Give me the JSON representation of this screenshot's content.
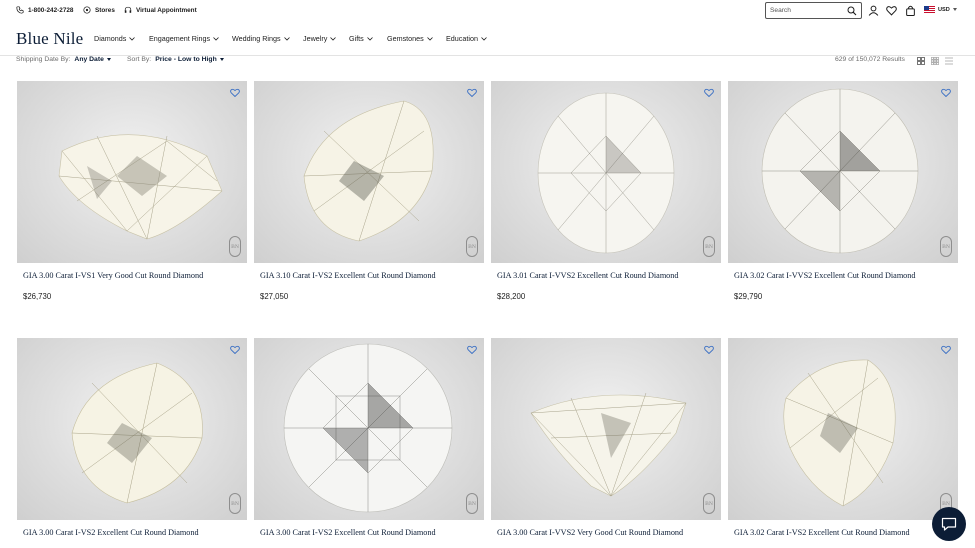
{
  "utility": {
    "phone": "1-800-242-2728",
    "stores": "Stores",
    "virtual": "Virtual Appointment",
    "search_placeholder": "Search",
    "currency": "USD"
  },
  "brand": {
    "name": "Blue Nile"
  },
  "nav": [
    "Diamonds",
    "Engagement Rings",
    "Wedding Rings",
    "Jewelry",
    "Gifts",
    "Gemstones",
    "Education"
  ],
  "filters": {
    "shipping_label": "Shipping Date By:",
    "shipping_value": "Any Date",
    "sort_label": "Sort By:",
    "sort_value": "Price - Low to High",
    "results": "629 of 150,072 Results"
  },
  "products": [
    {
      "title": "GIA 3.00 Carat I-VS1 Very Good Cut Round Diamond",
      "price": "$26,730"
    },
    {
      "title": "GIA 3.10 Carat I-VS2 Excellent Cut Round Diamond",
      "price": "$27,050"
    },
    {
      "title": "GIA 3.01 Carat I-VVS2 Excellent Cut Round Diamond",
      "price": "$28,200"
    },
    {
      "title": "GIA 3.02 Carat I-VVS2 Excellent Cut Round Diamond",
      "price": "$29,790"
    },
    {
      "title": "GIA 3.00 Carat I-VS2 Excellent Cut Round Diamond",
      "price": ""
    },
    {
      "title": "GIA 3.00 Carat I-VS2 Excellent Cut Round Diamond",
      "price": ""
    },
    {
      "title": "GIA 3.00 Carat I-VVS2 Very Good Cut Round Diamond",
      "price": ""
    },
    {
      "title": "GIA 3.02 Carat I-VS2 Excellent Cut Round Diamond",
      "price": ""
    }
  ],
  "watermark": "BN",
  "colors": {
    "brand_navy": "#0c1d36",
    "muted": "#6c6c6c",
    "image_bg": "#d9d9d9"
  },
  "icons": [
    "phone-icon",
    "location-pin-icon",
    "headset-icon",
    "search-icon",
    "user-icon",
    "heart-icon",
    "bag-icon",
    "us-flag-icon",
    "chevron-down-icon",
    "grid-large-icon",
    "grid-small-icon",
    "list-icon",
    "chat-icon"
  ]
}
